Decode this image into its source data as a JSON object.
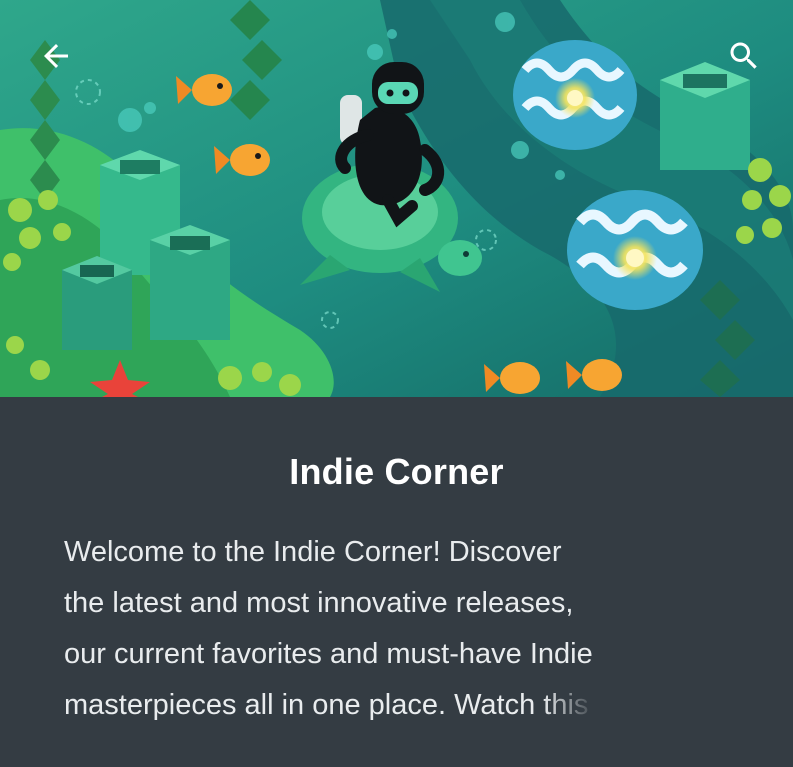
{
  "header": {
    "back_icon": "arrow-left-icon",
    "search_icon": "search-icon"
  },
  "hero": {
    "illustration": "underwater-diver-turtle-illustration"
  },
  "collection": {
    "title": "Indie Corner",
    "description_lines": [
      "Welcome to the Indie Corner! Discover",
      "the latest and most innovative releases,",
      "our current favorites and must-have Indie",
      "masterpieces all in one place. Watch this"
    ],
    "description_line4_lead": "masterpieces all in one place. Watch ",
    "description_line4_tail": "this"
  },
  "colors": {
    "background": "#343c43",
    "title": "#ffffff",
    "body_text": "#e9ecee"
  }
}
